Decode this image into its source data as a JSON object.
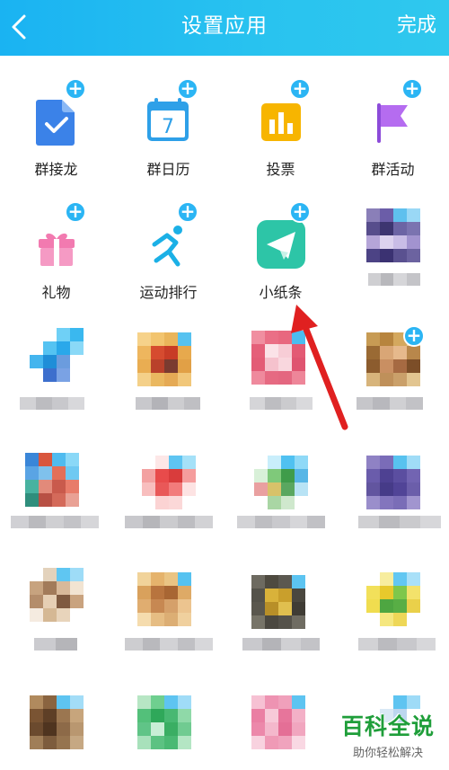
{
  "header": {
    "title": "设置应用",
    "done_label": "完成"
  },
  "apps": [
    {
      "label": "群接龙",
      "icon": "solitaire-doc-icon"
    },
    {
      "label": "群日历",
      "icon": "calendar-icon"
    },
    {
      "label": "投票",
      "icon": "vote-chart-icon"
    },
    {
      "label": "群活动",
      "icon": "flag-icon"
    },
    {
      "label": "礼物",
      "icon": "gift-icon"
    },
    {
      "label": "运动排行",
      "icon": "running-icon"
    },
    {
      "label": "小纸条",
      "icon": "paper-plane-icon"
    }
  ],
  "colors": {
    "header_start": "#1ab3f2",
    "header_end": "#2fc8ee",
    "badge": "#2bb5f4",
    "arrow": "#e02020",
    "watermark": "#1f9e3a"
  },
  "watermark": {
    "title": "百科全说",
    "subtitle": "助你轻松解决"
  }
}
